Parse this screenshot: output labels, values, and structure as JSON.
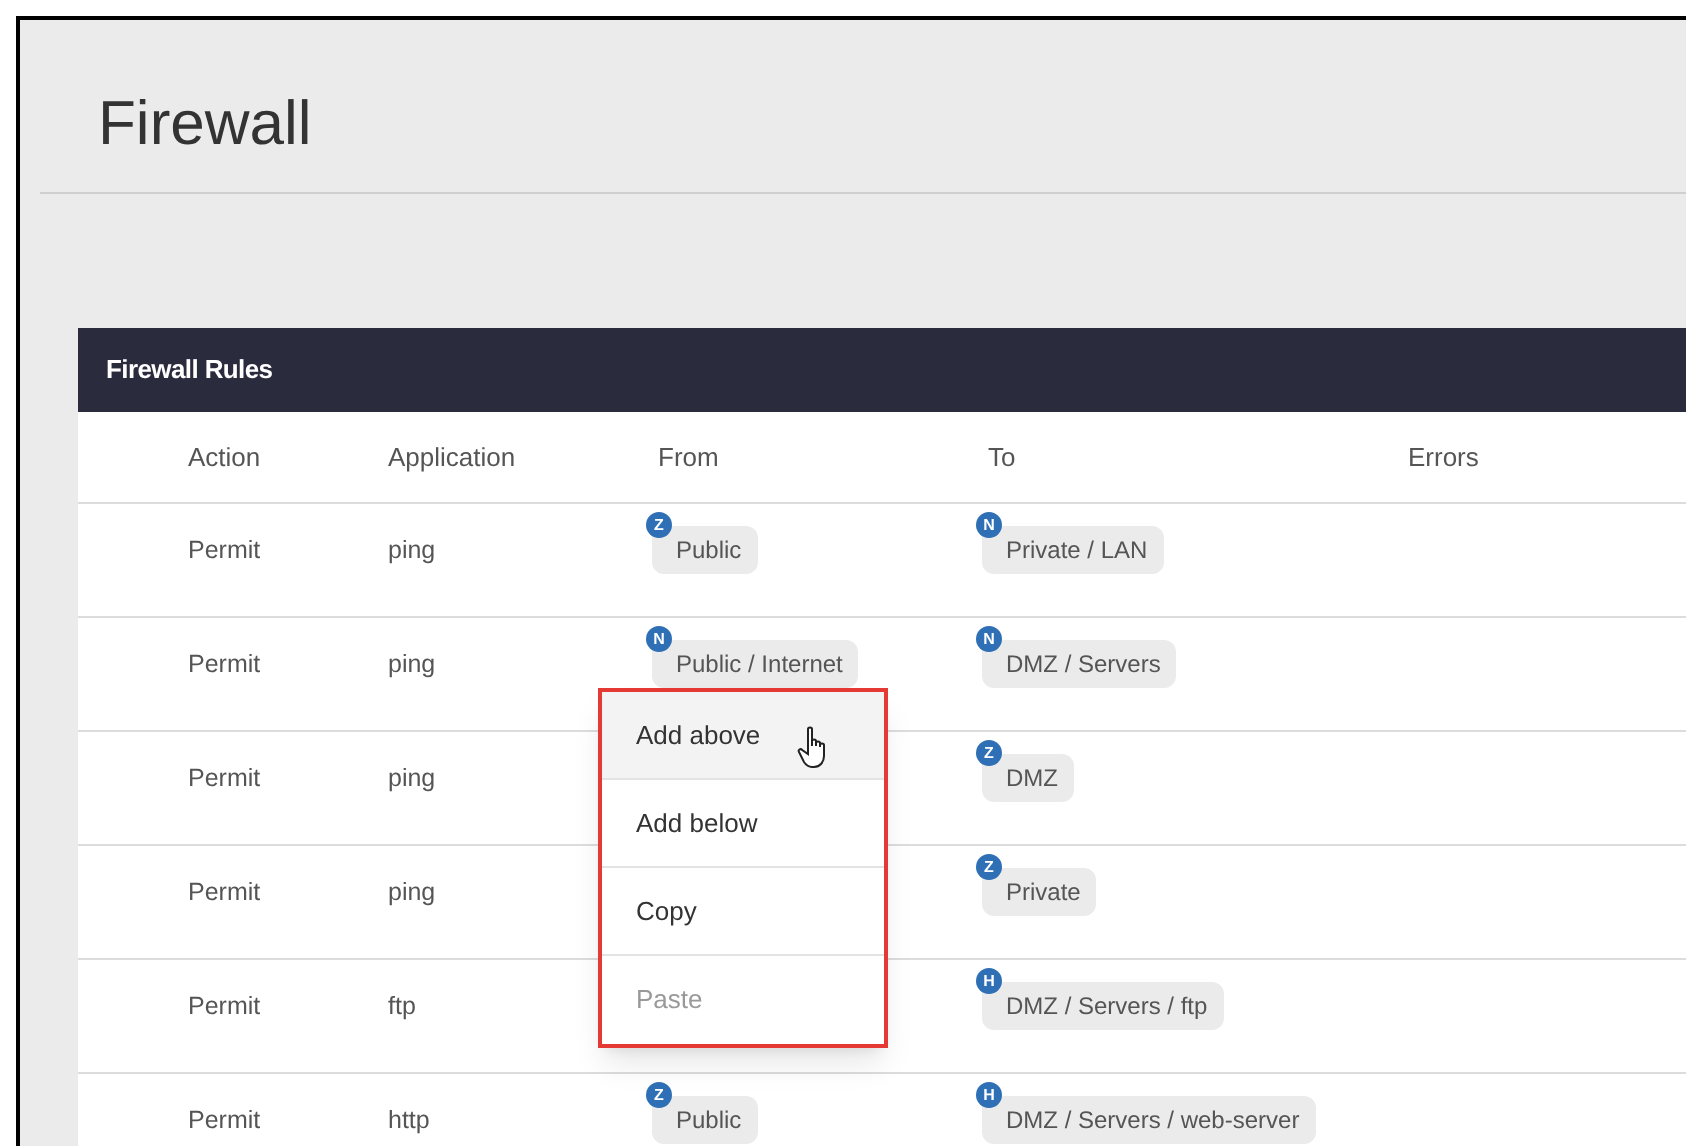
{
  "page": {
    "title": "Firewall"
  },
  "card": {
    "title": "Firewall Rules"
  },
  "table": {
    "columns": [
      "Action",
      "Application",
      "From",
      "To",
      "Errors"
    ],
    "rows": [
      {
        "action": "Permit",
        "application": "ping",
        "from": {
          "badge": "Z",
          "label": "Public"
        },
        "to": {
          "badge": "N",
          "label": "Private / LAN"
        }
      },
      {
        "action": "Permit",
        "application": "ping",
        "from": {
          "badge": "N",
          "label": "Public / Internet"
        },
        "to": {
          "badge": "N",
          "label": "DMZ / Servers"
        }
      },
      {
        "action": "Permit",
        "application": "ping",
        "to": {
          "badge": "Z",
          "label": "DMZ"
        }
      },
      {
        "action": "Permit",
        "application": "ping",
        "to": {
          "badge": "Z",
          "label": "Private"
        }
      },
      {
        "action": "Permit",
        "application": "ftp",
        "to": {
          "badge": "H",
          "label": "DMZ / Servers / ftp"
        }
      },
      {
        "action": "Permit",
        "application": "http",
        "from": {
          "badge": "Z",
          "label": "Public"
        },
        "to": {
          "badge": "H",
          "label": "DMZ / Servers / web-server"
        }
      }
    ]
  },
  "context_menu": {
    "items": [
      {
        "label": "Add above",
        "highlighted": true,
        "disabled": false
      },
      {
        "label": "Add below",
        "highlighted": false,
        "disabled": false
      },
      {
        "label": "Copy",
        "highlighted": false,
        "disabled": false
      },
      {
        "label": "Paste",
        "highlighted": false,
        "disabled": true
      }
    ]
  }
}
